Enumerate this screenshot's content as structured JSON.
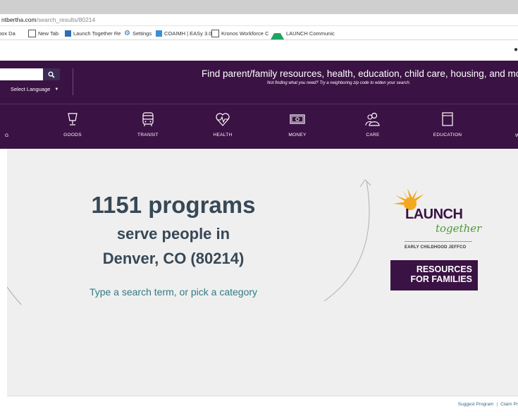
{
  "browser": {
    "url_host": "ntbertha.com",
    "url_path": "/search_results/80214",
    "bookmarks": [
      {
        "label": "box Da",
        "icon": "partial-icon"
      },
      {
        "label": "New Tab",
        "icon": "page-icon"
      },
      {
        "label": "Launch Together Re",
        "icon": "site-favicon-icon"
      },
      {
        "label": "Settings",
        "icon": "gear-icon"
      },
      {
        "label": "COAIMH | EASy 3.0",
        "icon": "cube-icon"
      },
      {
        "label": "Kronos Workforce C",
        "icon": "page-icon"
      },
      {
        "label": "LAUNCH Communic",
        "icon": "drive-icon"
      }
    ]
  },
  "header": {
    "search_placeholder": "",
    "language_label": "Select Language",
    "tagline": "Find parent/family resources, health, education, child care, housing, and more.",
    "subtagline": "Not finding what you need? Try a neighboring zip code to widen your search.",
    "categories": [
      {
        "label": "GOODS",
        "icon": "lamp-icon"
      },
      {
        "label": "TRANSIT",
        "icon": "bus-icon"
      },
      {
        "label": "HEALTH",
        "icon": "heart-pulse-icon"
      },
      {
        "label": "MONEY",
        "icon": "money-icon"
      },
      {
        "label": "CARE",
        "icon": "people-icon"
      },
      {
        "label": "EDUCATION",
        "icon": "book-icon"
      }
    ],
    "cat_partial_left": "G",
    "cat_partial_right": "W"
  },
  "main": {
    "count_line": "1151 programs",
    "serve_line": "serve people in",
    "location_line": "Denver, CO (80214)",
    "prompt": "Type a search term, or pick a category"
  },
  "logo": {
    "launch": "LAUNCH",
    "together": "together",
    "tagline": "EARLY CHILDHOOD JEFFCO",
    "resources_line1": "RESOURCES",
    "resources_line2": "FOR FAMILIES"
  },
  "footer": {
    "suggest": "Suggest Program",
    "separator": "|",
    "claim": "Claim Pr"
  },
  "colors": {
    "header_bg": "#3b1244",
    "text_dark": "#374856",
    "prompt_teal": "#317b86",
    "together_green": "#4e9a36",
    "sun_orange": "#f3a81f"
  }
}
